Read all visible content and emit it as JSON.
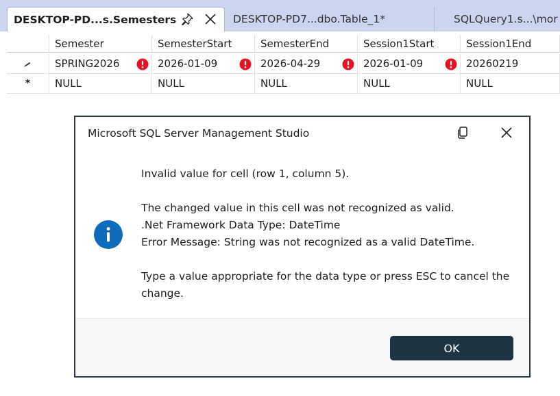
{
  "tabs": [
    {
      "label": "DESKTOP-PD...s.Semesters",
      "active": true
    },
    {
      "label": "DESKTOP-PD7...dbo.Table_1*",
      "active": false
    },
    {
      "label": "SQLQuery1.s...\\mor",
      "active": false
    }
  ],
  "grid": {
    "columns": [
      "Semester",
      "SemesterStart",
      "SemesterEnd",
      "Session1Start",
      "Session1End"
    ],
    "rows": [
      {
        "indicator": "edit-pencil",
        "cells": [
          "SPRING2026",
          "2026-01-09",
          "2026-04-29",
          "2026-01-09",
          "20260219"
        ],
        "errors": [
          true,
          true,
          true,
          true,
          false
        ]
      },
      {
        "indicator": "new-row-star",
        "cells": [
          "NULL",
          "NULL",
          "NULL",
          "NULL",
          "NULL"
        ]
      }
    ],
    "new_row_marker": "*"
  },
  "dialog": {
    "title": "Microsoft SQL Server Management Studio",
    "icon": "info-icon",
    "line1": "Invalid value for cell (row 1, column 5).",
    "line2": "The changed value in this cell was not recognized as valid.",
    "line3": ".Net Framework Data Type: DateTime",
    "line4": "Error Message: String was not recognized as a valid DateTime.",
    "line5": "Type a value appropriate for the data type or press ESC to cancel the",
    "line6": "change.",
    "ok_label": "OK"
  },
  "colors": {
    "tabstrip": "#ccd5f0",
    "error": "#e81123",
    "info": "#0f6cbd",
    "ok_button": "#1e3443"
  }
}
